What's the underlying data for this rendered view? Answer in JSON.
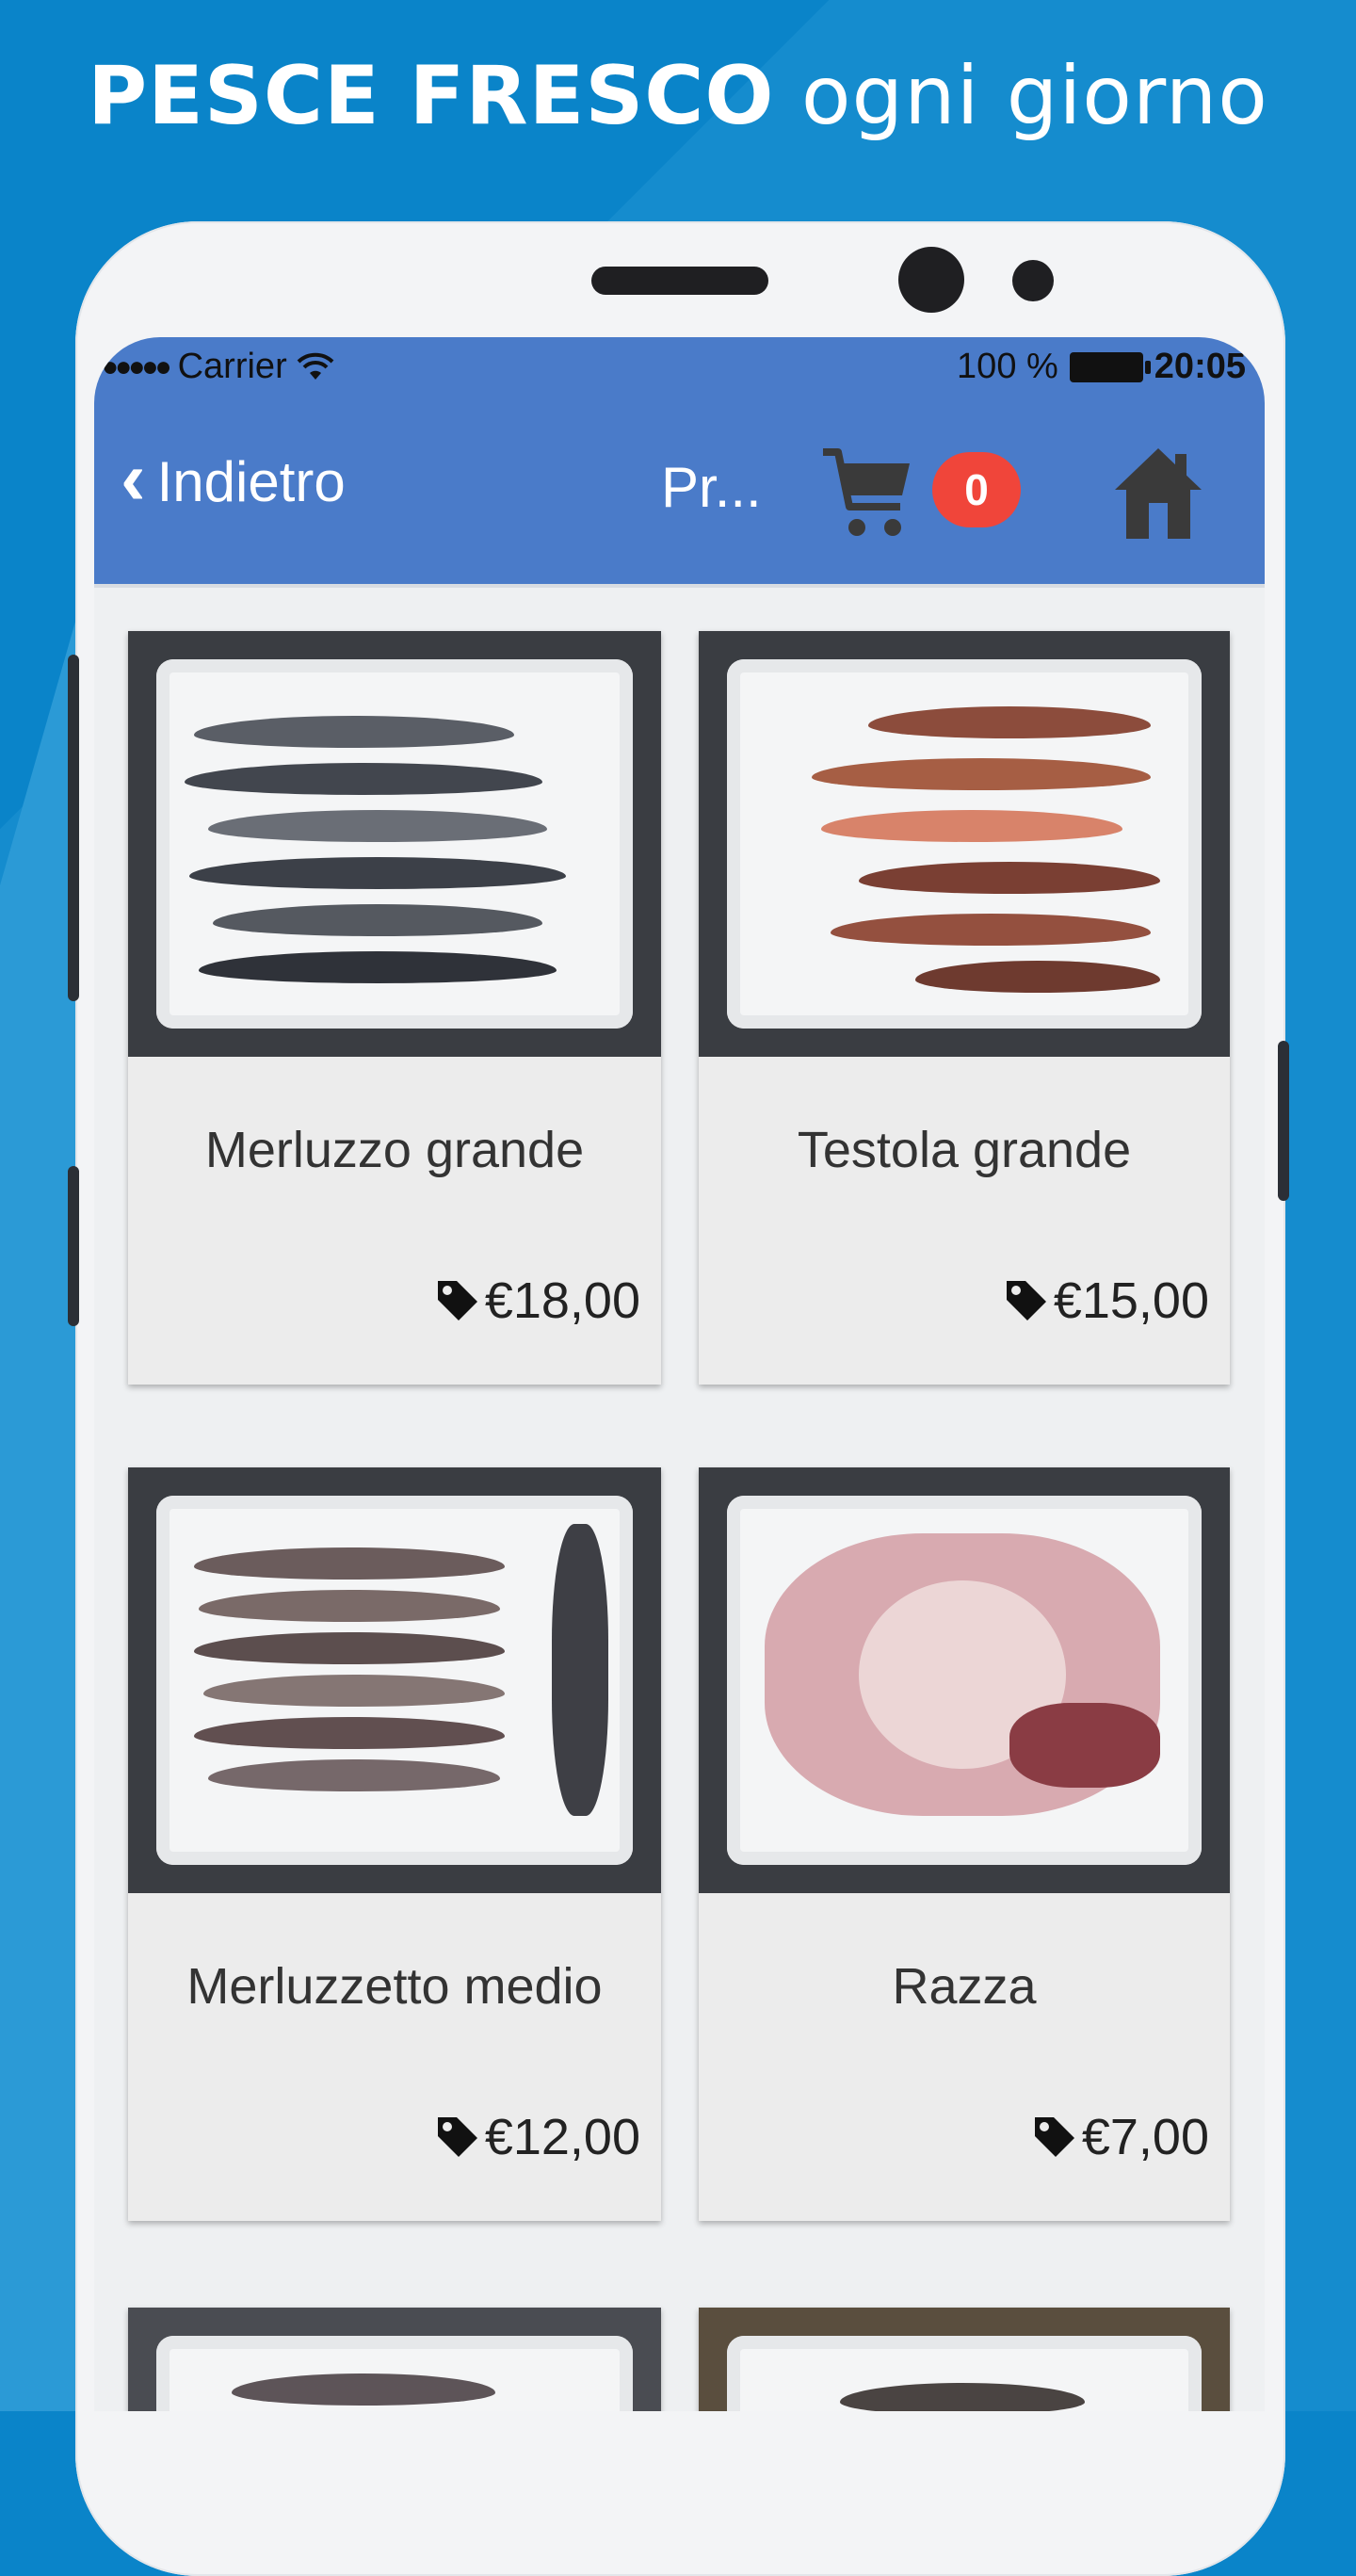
{
  "promo": {
    "headline_bold": "PESCE FRESCO",
    "headline_light": "ogni giorno"
  },
  "status_bar": {
    "signal_dots": "●●●●●",
    "carrier": "Carrier",
    "wifi_icon": "wifi-icon",
    "battery_percent": "100 %",
    "time": "20:05"
  },
  "navbar": {
    "back_label": "Indietro",
    "title": "Pr...",
    "cart_count": "0",
    "colors": {
      "bar": "#4a7bc9",
      "badge": "#f0453a"
    }
  },
  "products": [
    {
      "name": "Merluzzo grande",
      "price": "€18,00",
      "fish_color": "#4b4f57"
    },
    {
      "name": "Testola grande",
      "price": "€15,00",
      "fish_color": "#8a4a3c"
    },
    {
      "name": "Merluzzetto medio",
      "price": "€12,00",
      "fish_color": "#6b5c5c"
    },
    {
      "name": "Razza",
      "price": "€7,00",
      "fish_color": "#d8aab0"
    }
  ]
}
